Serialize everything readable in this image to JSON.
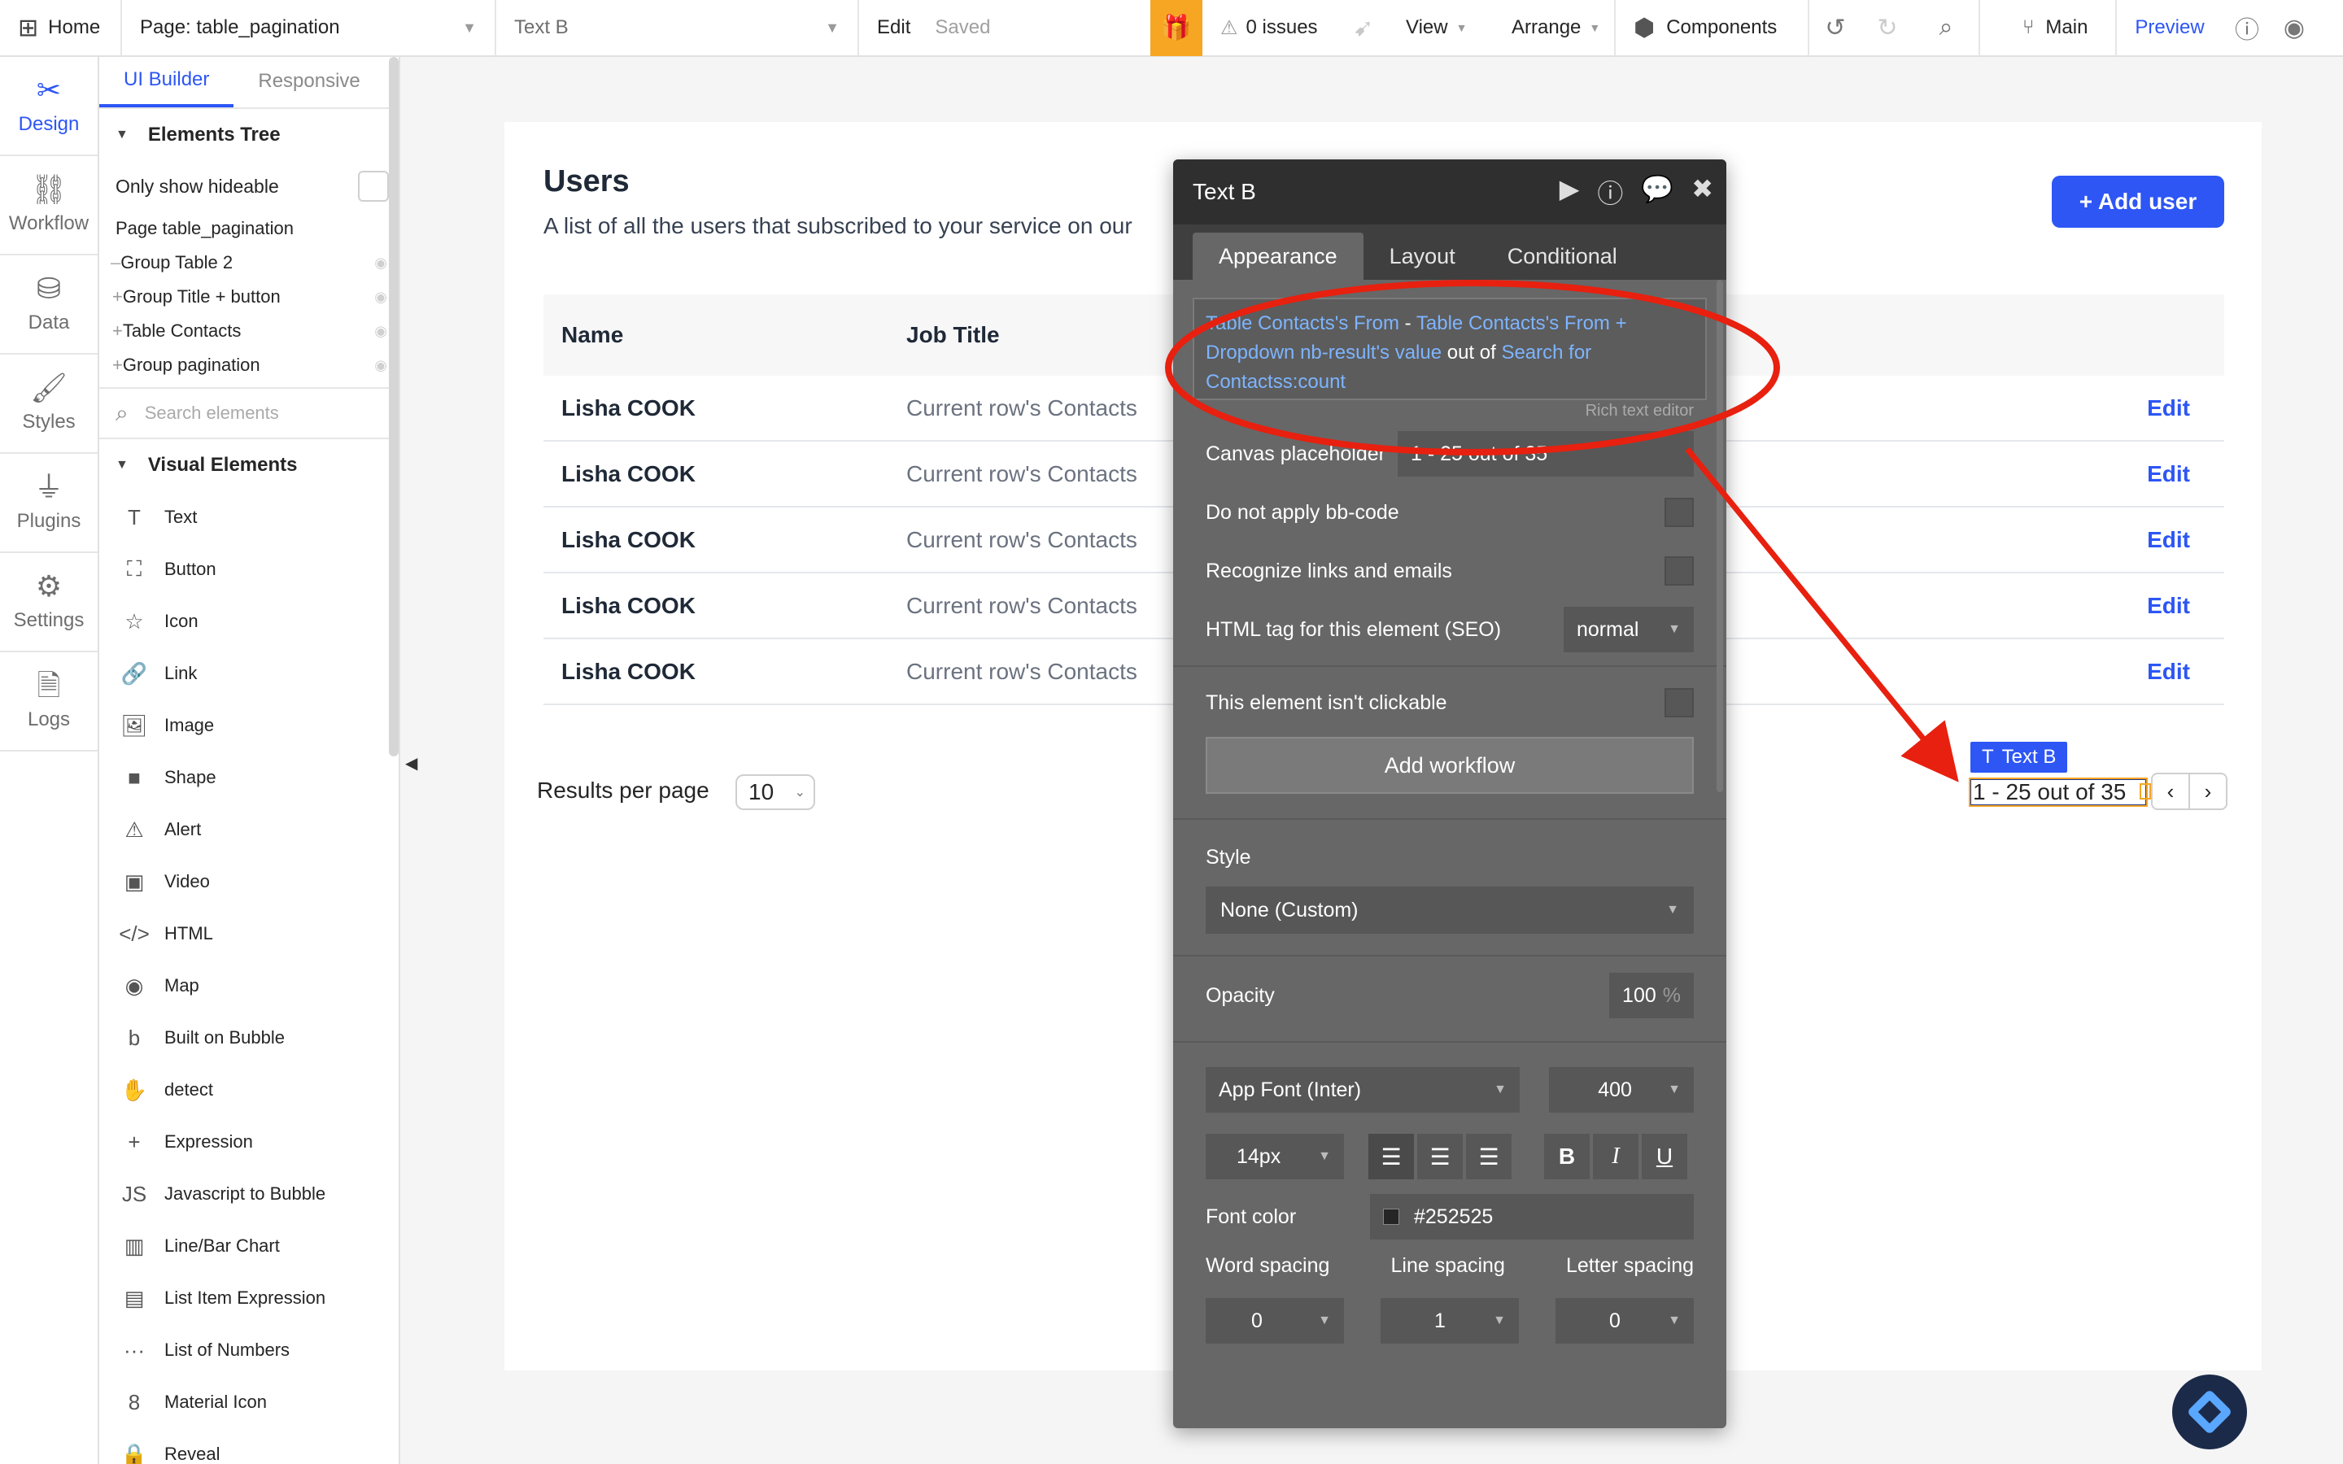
{
  "topbar": {
    "home": "Home",
    "page": "Page: table_pagination",
    "element": "Text B",
    "edit": "Edit",
    "saved": "Saved",
    "issues": "0 issues",
    "view": "View",
    "arrange": "Arrange",
    "components": "Components",
    "branch": "Main",
    "preview": "Preview"
  },
  "rail": [
    {
      "label": "Design",
      "icon": "design-icon"
    },
    {
      "label": "Workflow",
      "icon": "workflow-icon"
    },
    {
      "label": "Data",
      "icon": "database-icon"
    },
    {
      "label": "Styles",
      "icon": "brush-icon"
    },
    {
      "label": "Plugins",
      "icon": "plug-icon"
    },
    {
      "label": "Settings",
      "icon": "gear-icon"
    },
    {
      "label": "Logs",
      "icon": "document-icon"
    }
  ],
  "panel": {
    "tabs": [
      "UI Builder",
      "Responsive"
    ],
    "elements_tree": "Elements Tree",
    "only_hideable": "Only show hideable",
    "tree": [
      "Page table_pagination",
      "Group Table 2",
      "Group Title + button",
      "Table Contacts",
      "Group pagination"
    ],
    "search_placeholder": "Search elements",
    "visual_elements": "Visual Elements",
    "visual_items": [
      {
        "label": "Text",
        "icon": "T"
      },
      {
        "label": "Button",
        "icon": "⛶"
      },
      {
        "label": "Icon",
        "icon": "☆"
      },
      {
        "label": "Link",
        "icon": "🔗"
      },
      {
        "label": "Image",
        "icon": "🖼"
      },
      {
        "label": "Shape",
        "icon": "■"
      },
      {
        "label": "Alert",
        "icon": "⚠"
      },
      {
        "label": "Video",
        "icon": "▣"
      },
      {
        "label": "HTML",
        "icon": "</>"
      },
      {
        "label": "Map",
        "icon": "◉"
      },
      {
        "label": "Built on Bubble",
        "icon": "b"
      },
      {
        "label": "detect",
        "icon": "✋"
      },
      {
        "label": "Expression",
        "icon": "+"
      },
      {
        "label": "Javascript to Bubble",
        "icon": "JS"
      },
      {
        "label": "Line/Bar Chart",
        "icon": "▥"
      },
      {
        "label": "List Item Expression",
        "icon": "▤"
      },
      {
        "label": "List of Numbers",
        "icon": "···"
      },
      {
        "label": "Material Icon",
        "icon": "8"
      },
      {
        "label": "Reveal",
        "icon": "🔒"
      }
    ]
  },
  "canvas": {
    "title": "Users",
    "subtitle": "A list of all the users that subscribed to your service on our",
    "add_user": "+ Add user",
    "columns": [
      "Name",
      "Job Title"
    ],
    "rows": [
      {
        "name": "Lisha COOK",
        "job": "Current row's Contacts",
        "action": "Edit"
      },
      {
        "name": "Lisha COOK",
        "job": "Current row's Contacts",
        "action": "Edit"
      },
      {
        "name": "Lisha COOK",
        "job": "Current row's Contacts",
        "action": "Edit"
      },
      {
        "name": "Lisha COOK",
        "job": "Current row's Contacts",
        "action": "Edit"
      },
      {
        "name": "Lisha COOK",
        "job": "Current row's Contacts",
        "action": "Edit"
      }
    ],
    "results_per_page": "Results per page",
    "rpp_value": "10",
    "textb_tag": "Text B",
    "textb_value": "1 - 25 out of 35",
    "prev": "‹",
    "next": "›"
  },
  "editor": {
    "title": "Text B",
    "tabs": [
      "Appearance",
      "Layout",
      "Conditional"
    ],
    "expr": {
      "part1": "Table Contacts's From",
      "sep1": " - ",
      "part2": "Table Contacts's From +",
      "part3": "Dropdown nb-result's value",
      "sep2": " out of ",
      "part4": "Search for",
      "part5": "Contactss:count"
    },
    "rte_label": "Rich text editor",
    "canvas_placeholder_label": "Canvas placeholder",
    "canvas_placeholder_value": "1 - 25 out of 35",
    "no_bbcode": "Do not apply bb-code",
    "recognize_links": "Recognize links and emails",
    "html_tag_label": "HTML tag for this element (SEO)",
    "html_tag_value": "normal",
    "not_clickable": "This element isn't clickable",
    "add_workflow": "Add workflow",
    "style_label": "Style",
    "style_value": "None (Custom)",
    "opacity_label": "Opacity",
    "opacity_value": "100",
    "opacity_unit": "%",
    "font_value": "App Font (Inter)",
    "weight_value": "400",
    "size_value": "14px",
    "font_color_label": "Font color",
    "font_color_value": "#252525",
    "word_spacing_label": "Word spacing",
    "line_spacing_label": "Line spacing",
    "letter_spacing_label": "Letter spacing",
    "word_spacing_value": "0",
    "line_spacing_value": "1",
    "letter_spacing_value": "0"
  },
  "colors": {
    "accent": "#2d56f5",
    "annotation": "#e8200f",
    "editor_bg": "#676767",
    "gift": "#f6a623"
  }
}
